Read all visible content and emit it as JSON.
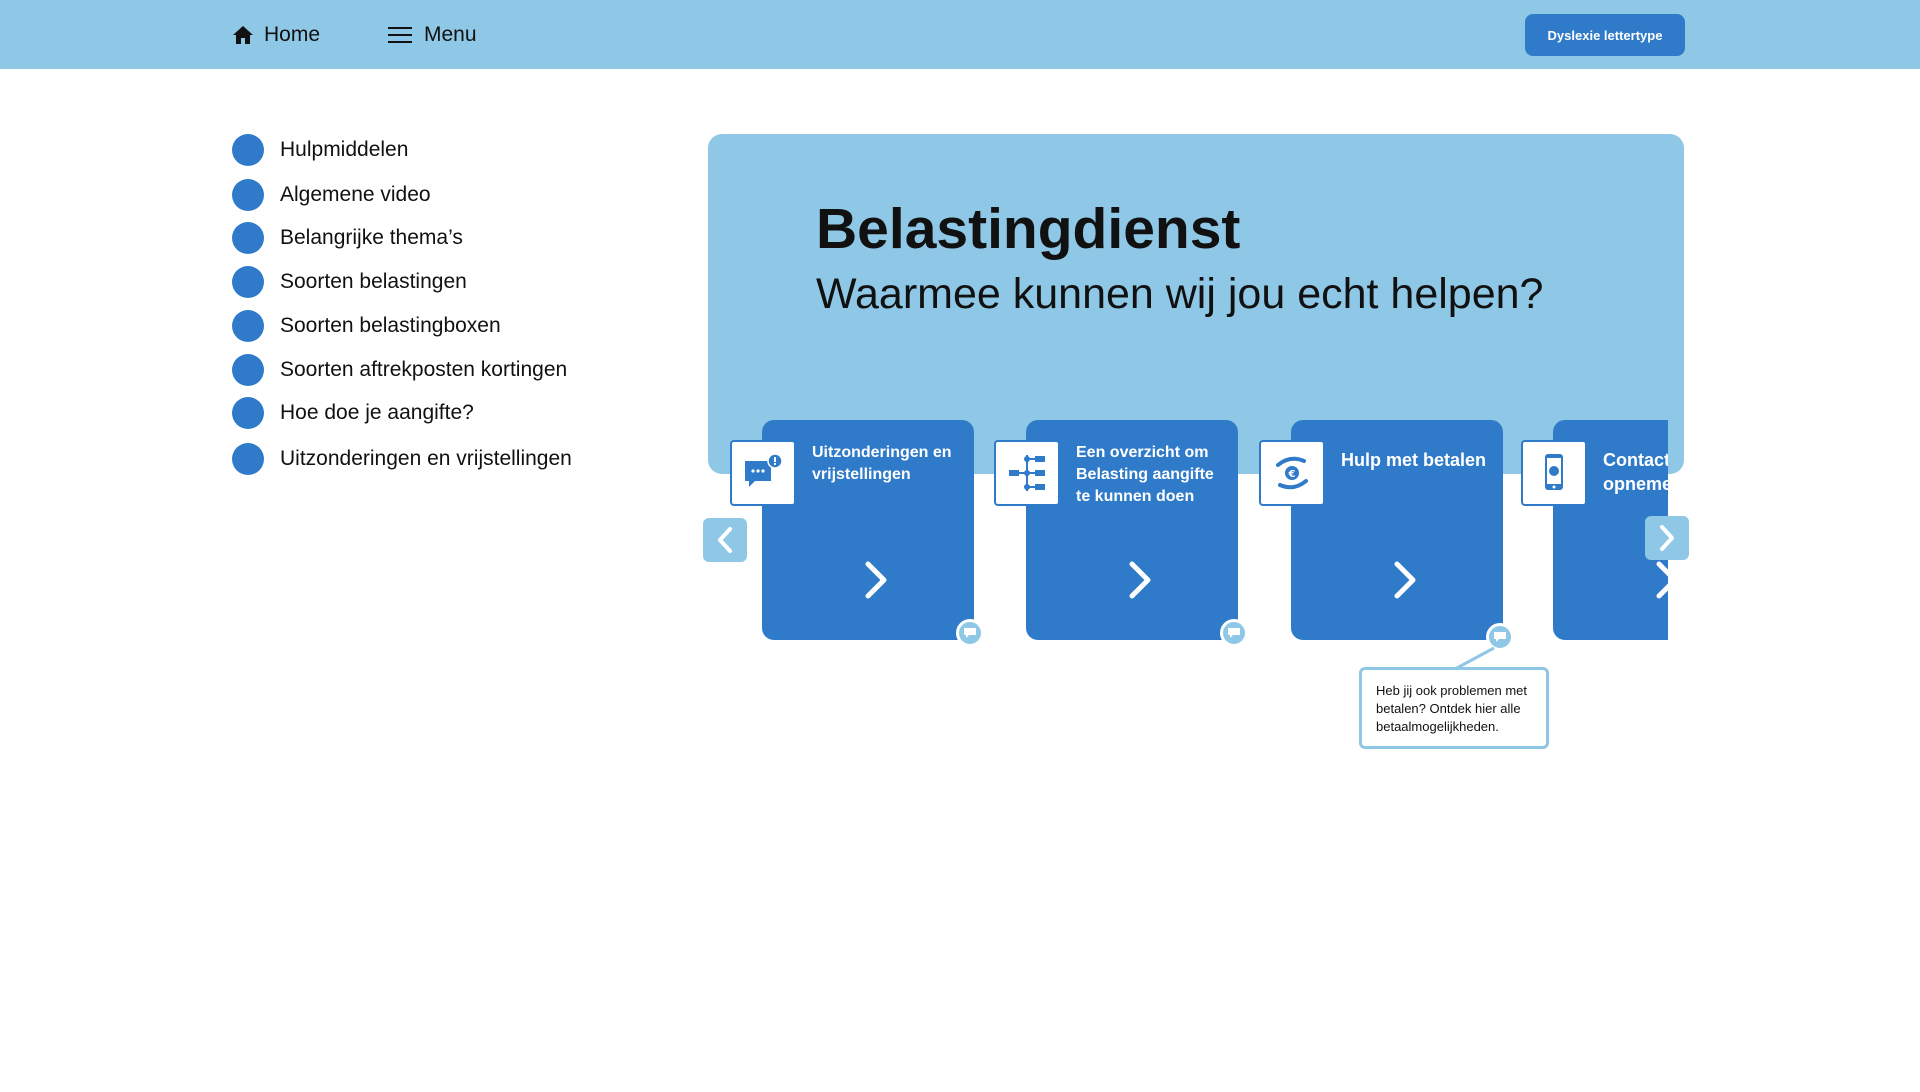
{
  "topbar": {
    "home_label": "Home",
    "menu_label": "Menu",
    "dyslexia_button": "Dyslexie lettertype"
  },
  "sidebar": {
    "items": [
      {
        "label": "Hulpmiddelen"
      },
      {
        "label": "Algemene video"
      },
      {
        "label": "Belangrijke thema’s"
      },
      {
        "label": "Soorten belastingen"
      },
      {
        "label": "Soorten belastingboxen"
      },
      {
        "label": "Soorten aftrekposten kortingen"
      },
      {
        "label": "Hoe doe je aangifte?"
      },
      {
        "label": "Uitzonderingen en vrijstellingen"
      }
    ]
  },
  "hero": {
    "title": "Belastingdienst",
    "subtitle": "Waarmee kunnen wij jou echt helpen?"
  },
  "cards": [
    {
      "label": "Uitzonderingen en vrijstellingen",
      "icon": "chat-alert-icon"
    },
    {
      "label": "Een overzicht om Belasting aangifte te kunnen doen",
      "icon": "flowchart-icon"
    },
    {
      "label": "Hulp met betalen",
      "icon": "euro-hands-icon"
    },
    {
      "label": "Contact opnemen",
      "icon": "phone-icon"
    }
  ],
  "tooltip": {
    "text": "Heb jij ook problemen met betalen? Ontdek hier alle betaalmogelijkheden."
  },
  "colors": {
    "topbar": "#8fc8e6",
    "accent": "#2f7bc9",
    "text": "#111111"
  }
}
